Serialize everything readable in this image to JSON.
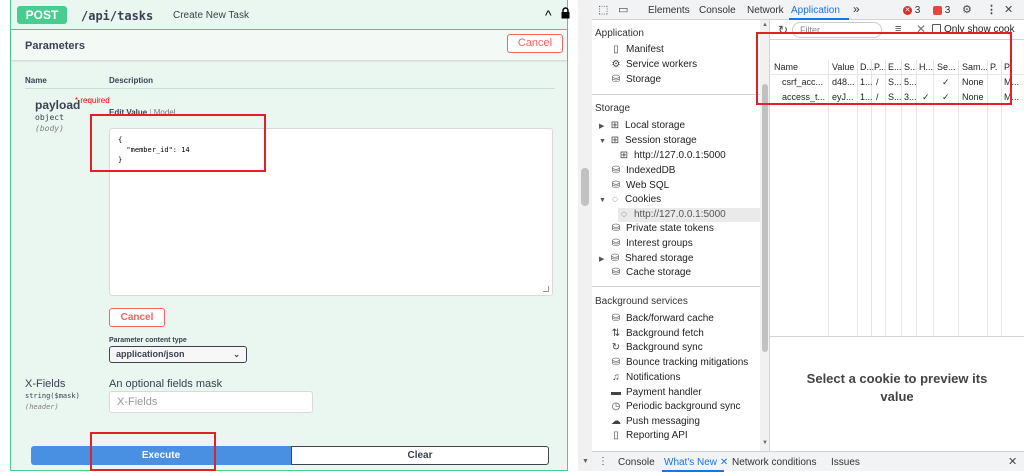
{
  "swagger": {
    "method": "POST",
    "path": "/api/tasks",
    "summary": "Create New Task",
    "params_title": "Parameters",
    "cancel_label": "Cancel",
    "col_name": "Name",
    "col_description": "Description",
    "payload": {
      "name": "payload",
      "required": "* required",
      "type": "object",
      "in": "(body)",
      "tab_edit": "Edit Value",
      "tab_sep": " | ",
      "tab_model": "Model",
      "body": "{\n  \"member_id\": 14\n}"
    },
    "body_cancel_label": "Cancel",
    "content_type_label": "Parameter content type",
    "content_type_value": "application/json",
    "xfields": {
      "name": "X-Fields",
      "type": "string($mask)",
      "in": "(header)",
      "description": "An optional fields mask",
      "placeholder": "X-Fields"
    },
    "execute_label": "Execute",
    "clear_label": "Clear"
  },
  "devtools": {
    "tabs": [
      "Elements",
      "Console",
      "Network",
      "Application"
    ],
    "more_tabs": "»",
    "error_count": "3",
    "warning_count": "3",
    "sidebar": {
      "application_title": "Application",
      "application_items": [
        "Manifest",
        "Service workers",
        "Storage"
      ],
      "storage_title": "Storage",
      "storage_items": {
        "local_storage": "Local storage",
        "session_storage": "Session storage",
        "session_origin": "http://127.0.0.1:5000",
        "indexeddb": "IndexedDB",
        "websql": "Web SQL",
        "cookies": "Cookies",
        "cookies_origin": "http://127.0.0.1:5000",
        "private_state_tokens": "Private state tokens",
        "interest_groups": "Interest groups",
        "shared_storage": "Shared storage",
        "cache_storage": "Cache storage"
      },
      "background_title": "Background services",
      "background_items": [
        "Back/forward cache",
        "Background fetch",
        "Background sync",
        "Bounce tracking mitigations",
        "Notifications",
        "Payment handler",
        "Periodic background sync",
        "Push messaging",
        "Reporting API"
      ]
    },
    "toolbar": {
      "filter_placeholder": "Filter",
      "only_show": "Only show cook"
    },
    "cookie_table": {
      "headers": [
        "Name",
        "Value",
        "D...",
        "P...",
        "E...",
        "S...",
        "H...",
        "Se...",
        "Sam...",
        "P.",
        "P"
      ],
      "rows": [
        [
          "csrf_acc...",
          "d48...",
          "1...",
          "/",
          "S...",
          "5...",
          "",
          "✓",
          "None",
          "",
          "M..."
        ],
        [
          "access_t...",
          "eyJ...",
          "1...",
          "/",
          "S...",
          "3...",
          "✓",
          "✓",
          "None",
          "",
          "M..."
        ]
      ]
    },
    "preview_text": "Select a cookie to preview its value",
    "drawer": {
      "tabs": [
        "Console",
        "What's New",
        "Network conditions",
        "Issues"
      ]
    }
  }
}
